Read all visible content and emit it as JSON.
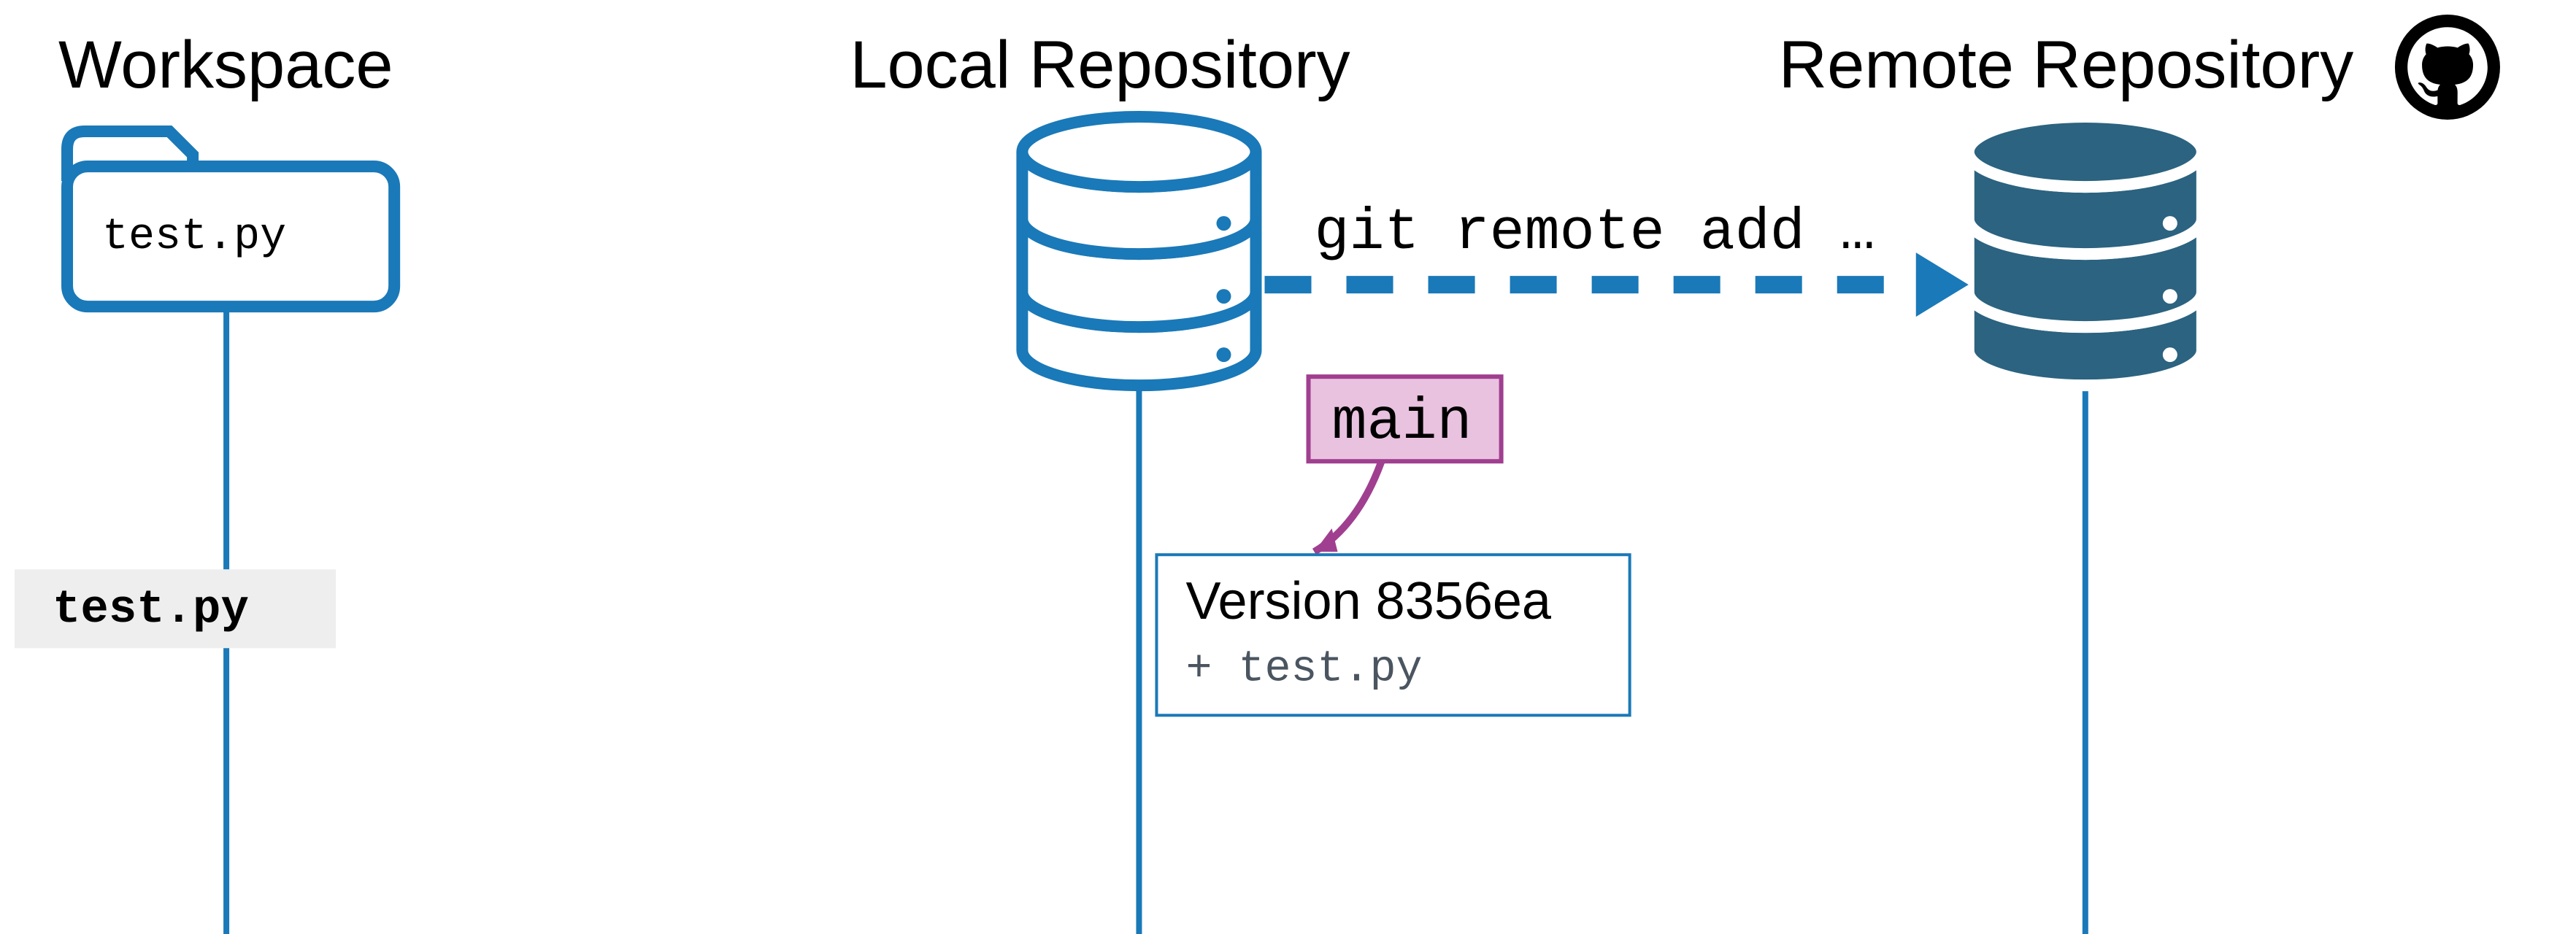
{
  "colors": {
    "blue": "#1a79b8",
    "darkTeal": "#2b6380",
    "pinkFill": "#e9c2df",
    "pinkStroke": "#a03f8f",
    "grey": "#eeeeee",
    "black": "#000000"
  },
  "headings": {
    "workspace": "Workspace",
    "local": "Local Repository",
    "remote": "Remote Repository"
  },
  "folder": {
    "file": "test.py"
  },
  "tracked_file_label": "test.py",
  "command": "git remote add …",
  "branch": "main",
  "commit": {
    "title": "Version 8356ea",
    "sub": "+ test.py"
  }
}
